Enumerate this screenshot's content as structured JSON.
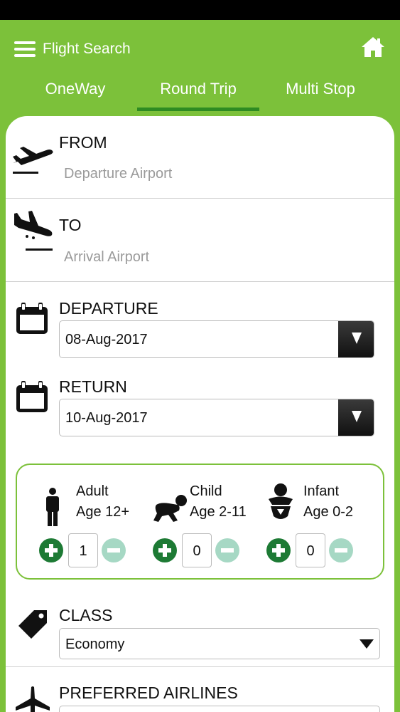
{
  "header": {
    "title": "Flight Search"
  },
  "tabs": [
    {
      "label": "OneWay"
    },
    {
      "label": "Round Trip"
    },
    {
      "label": "Multi Stop"
    }
  ],
  "active_tab": "Round Trip",
  "accent_color": "#7cc13a",
  "form": {
    "from": {
      "label": "FROM",
      "placeholder": "Departure Airport",
      "icon": "plane-takeoff-icon"
    },
    "to": {
      "label": "TO",
      "placeholder": "Arrival Airport",
      "icon": "plane-landing-icon"
    },
    "departure": {
      "label": "DEPARTURE",
      "value": "08-Aug-2017",
      "icon": "calendar-icon"
    },
    "return": {
      "label": "RETURN",
      "value": "10-Aug-2017",
      "icon": "calendar-icon"
    },
    "passengers": [
      {
        "type": "Adult",
        "age": "Age 12+",
        "count": "1",
        "icon": "adult-icon"
      },
      {
        "type": "Child",
        "age": "Age 2-11",
        "count": "0",
        "icon": "child-icon"
      },
      {
        "type": "Infant",
        "age": "Age 0-2",
        "count": "0",
        "icon": "infant-icon"
      }
    ],
    "class": {
      "label": "CLASS",
      "value": "Economy",
      "icon": "tag-icon"
    },
    "airlines": {
      "label": "PREFERRED AIRLINES",
      "icon": "airplane-icon"
    }
  }
}
